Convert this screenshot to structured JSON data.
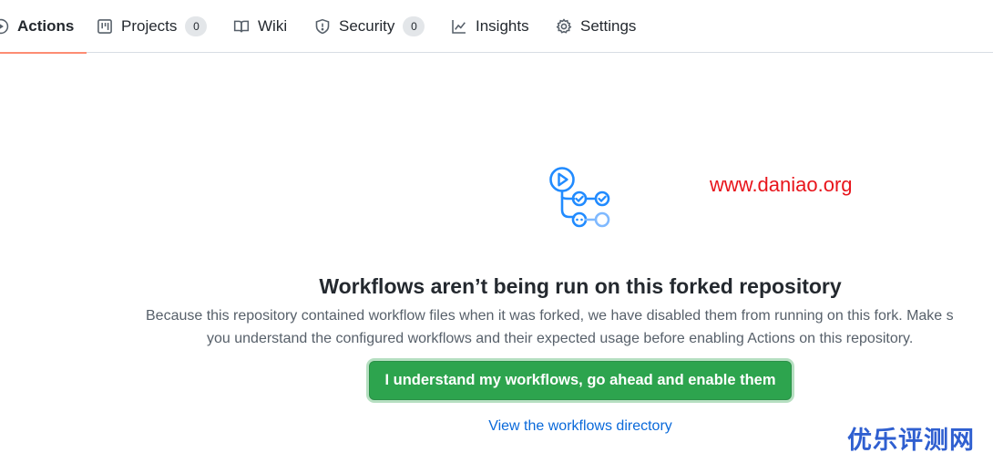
{
  "tabs": [
    {
      "label": "Actions",
      "icon": "play-icon",
      "active": true
    },
    {
      "label": "Projects",
      "icon": "project-board-icon",
      "count": "0"
    },
    {
      "label": "Wiki",
      "icon": "book-icon"
    },
    {
      "label": "Security",
      "icon": "shield-icon",
      "count": "0"
    },
    {
      "label": "Insights",
      "icon": "graph-icon"
    },
    {
      "label": "Settings",
      "icon": "gear-icon"
    }
  ],
  "watermark": "www.daniao.org",
  "blankslate": {
    "title": "Workflows aren’t being run on this forked repository",
    "description_line1": "Because this repository contained workflow files when it was forked, we have disabled them from running on this fork. Make s",
    "description_line2": "you understand the configured workflows and their expected usage before enabling Actions on this repository.",
    "enable_button": "I understand my workflows, go ahead and enable them",
    "directory_link": "View the workflows directory"
  },
  "brand_mark": "优乐评测网",
  "colors": {
    "accent_underline": "#fd8c73",
    "primary_button": "#2da44e",
    "link": "#0969da",
    "workflow_icon": "#218bff",
    "watermark": "#e8141b",
    "brand_mark": "#2f5fd0"
  }
}
